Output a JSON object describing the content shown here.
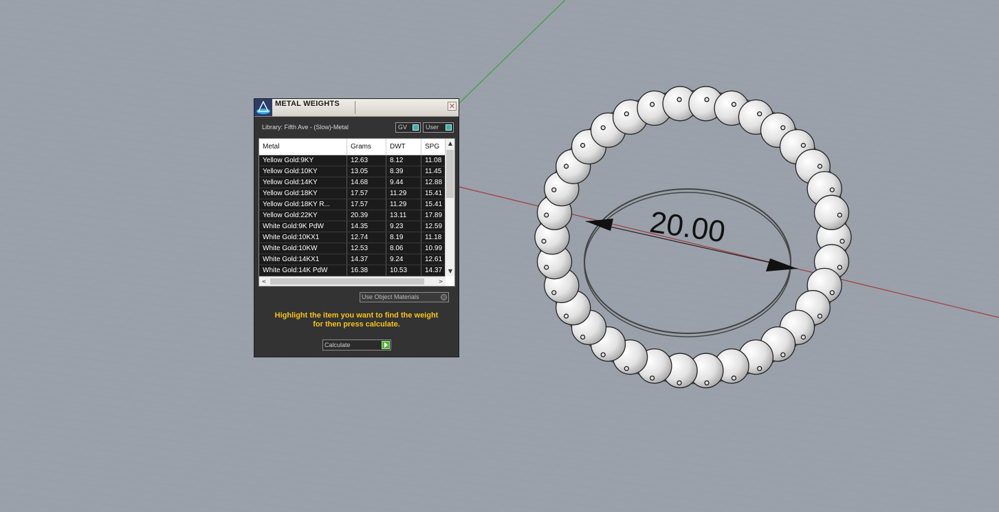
{
  "viewport": {
    "dimension_label": "20.00",
    "colors": {
      "background": "#9aa1aa",
      "grid": "#8f969f",
      "x_axis": "#a23a3a",
      "y_axis": "#3fa33f"
    }
  },
  "dialog": {
    "title": "METAL WEIGHTS",
    "close_icon": "×",
    "library_label": "Library: Fifth Ave - (Slow)-Metal",
    "toggle_gv": "GV",
    "toggle_user": "User",
    "columns": [
      "Metal",
      "Grams",
      "DWT",
      "SPG"
    ],
    "rows": [
      [
        "Yellow Gold:9KY",
        "12.63",
        "8.12",
        "11.08"
      ],
      [
        "Yellow Gold:10KY",
        "13.05",
        "8.39",
        "11.45"
      ],
      [
        "Yellow Gold:14KY",
        "14.68",
        "9.44",
        "12.88"
      ],
      [
        "Yellow Gold:18KY",
        "17.57",
        "11.29",
        "15.41"
      ],
      [
        "Yellow Gold:18KY R...",
        "17.57",
        "11.29",
        "15.41"
      ],
      [
        "Yellow Gold:22KY",
        "20.39",
        "13.11",
        "17.89"
      ],
      [
        "White Gold:9K PdW",
        "14.35",
        "9.23",
        "12.59"
      ],
      [
        "White Gold:10KX1",
        "12.74",
        "8.19",
        "11.18"
      ],
      [
        "White Gold:10KW",
        "12.53",
        "8.06",
        "10.99"
      ],
      [
        "White Gold:14KX1",
        "14.37",
        "9.24",
        "12.61"
      ],
      [
        "White Gold:14K PdW",
        "16.38",
        "10.53",
        "14.37"
      ]
    ],
    "scroll_up": "▲",
    "scroll_down": "▼",
    "scroll_left": "<",
    "scroll_right": ">",
    "use_object_materials": "Use Object Materials",
    "hint_line1": "Highlight the item you want to find the weight",
    "hint_line2": "for then press calculate.",
    "calculate_label": "Calculate",
    "colors": {
      "hint": "#f5c518",
      "panel": "#333333",
      "row_bg": "#1b1b1b",
      "toggle_knob": "#3fb0b0",
      "go_button": "#4fb43a"
    }
  }
}
